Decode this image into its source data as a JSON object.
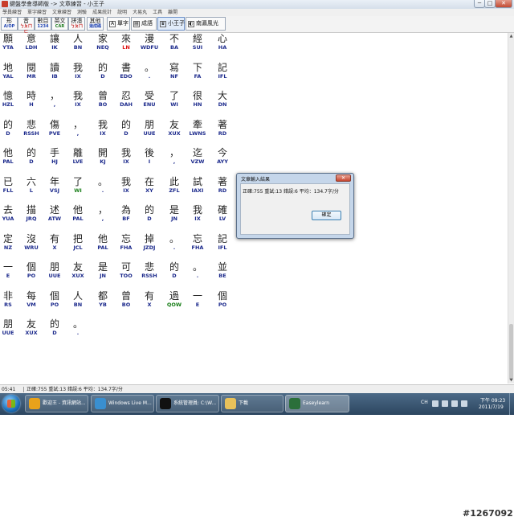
{
  "window": {
    "title": "鍵盤學會導師版 -> 文章練習 - 小王子",
    "controls": {
      "minimize": "─",
      "maximize": "□",
      "close": "✕"
    }
  },
  "menu": [
    "學員練習",
    "單字練習",
    "文章練習",
    "測驗",
    "成果統計",
    "說明",
    "大易丸",
    "工具",
    "離開"
  ],
  "toolbar": {
    "buttons": [
      {
        "top": "形",
        "bottom": "A/OP",
        "color": "#1a3fb0"
      },
      {
        "top": "音",
        "bottom": "ㄅㄆㄇㄈ",
        "color": "#c21a1a"
      },
      {
        "top": "數目",
        "bottom": "1234",
        "color": "#1a3fb0"
      },
      {
        "top": "英文",
        "bottom": "CAR",
        "color": "#1d7a1d"
      },
      {
        "top": "拼湊",
        "bottom": "ㄅㄆㄇ",
        "color": "#c21a1a"
      },
      {
        "top": "其他",
        "bottom": "速成碼",
        "color": "#1a3fb0"
      }
    ],
    "modes": [
      {
        "label": "單字",
        "icon": "A"
      },
      {
        "label": "成語",
        "icon": "▤"
      },
      {
        "label": "小王子",
        "icon": "♛"
      },
      {
        "label": "南瀛風光",
        "icon": "◐"
      }
    ]
  },
  "text_rows": [
    {
      "chars": [
        "願",
        "意",
        "讓",
        "人",
        "家",
        "來",
        "漫",
        "不",
        "經",
        "心"
      ],
      "codes": [
        "YTA",
        "LDH",
        "IK",
        "BN",
        "NEQ",
        "LN",
        "WDFU",
        "BA",
        "SUI",
        "HA"
      ],
      "code_colors": [
        "",
        "",
        "",
        "",
        "",
        "red",
        "",
        "",
        "",
        ""
      ]
    },
    {
      "chars": [
        "地",
        "閱",
        "讀",
        "我",
        "的",
        "書",
        "。",
        "寫",
        "下",
        "記"
      ],
      "codes": [
        "YAL",
        "MR",
        "IB",
        "IX",
        "D",
        "EDO",
        ".",
        "NF",
        "FA",
        "IFL"
      ],
      "code_colors": [
        "",
        "",
        "",
        "",
        "",
        "",
        "",
        "",
        "",
        ""
      ]
    },
    {
      "chars": [
        "憶",
        "時",
        "，",
        "我",
        "曾",
        "忍",
        "受",
        "了",
        "很",
        "大"
      ],
      "codes": [
        "HZL",
        "H",
        ",",
        "IX",
        "BO",
        "DAH",
        "ENU",
        "WI",
        "HN",
        "DN"
      ],
      "code_colors": [
        "",
        "",
        "",
        "",
        "",
        "",
        "",
        "",
        "",
        ""
      ]
    },
    {
      "chars": [
        "的",
        "悲",
        "傷",
        "，",
        "我",
        "的",
        "朋",
        "友",
        "牽",
        "著"
      ],
      "codes": [
        "D",
        "RSSH",
        "PVE",
        ",",
        "IX",
        "D",
        "UUE",
        "XUX",
        "LWNS",
        "RD"
      ],
      "code_colors": [
        "",
        "",
        "",
        "",
        "",
        "",
        "",
        "",
        "",
        ""
      ]
    },
    {
      "chars": [
        "他",
        "的",
        "手",
        "離",
        "開",
        "我",
        "後",
        "，",
        "迄",
        "今"
      ],
      "codes": [
        "PAL",
        "D",
        "HJ",
        "LVE",
        "KJ",
        "IX",
        "I",
        ",",
        "VZW",
        "AYY"
      ],
      "code_colors": [
        "",
        "",
        "",
        "",
        "",
        "",
        "",
        "",
        "",
        ""
      ]
    },
    {
      "chars": [
        "已",
        "六",
        "年",
        "了",
        "。",
        "我",
        "在",
        "此",
        "試",
        "著"
      ],
      "codes": [
        "FLL",
        "L",
        "VSJ",
        "WI",
        ".",
        "IX",
        "XY",
        "ZFL",
        "IAXI",
        "RD"
      ],
      "code_colors": [
        "",
        "",
        "",
        "green",
        "",
        "",
        "",
        "",
        "",
        ""
      ]
    },
    {
      "chars": [
        "去",
        "描",
        "述",
        "他",
        "，",
        "為",
        "的",
        "是",
        "我",
        "確"
      ],
      "codes": [
        "YUA",
        "JRQ",
        "ATW",
        "PAL",
        ",",
        "BF",
        "D",
        "JN",
        "IX",
        "LV"
      ],
      "code_colors": [
        "",
        "",
        "",
        "",
        "",
        "",
        "",
        "",
        "",
        ""
      ]
    },
    {
      "chars": [
        "定",
        "沒",
        "有",
        "把",
        "他",
        "忘",
        "掉",
        "。",
        "忘",
        "記"
      ],
      "codes": [
        "NZ",
        "WRU",
        "X",
        "JCL",
        "PAL",
        "FHA",
        "JZDJ",
        ".",
        "FHA",
        "IFL"
      ],
      "code_colors": [
        "",
        "",
        "",
        "",
        "",
        "",
        "",
        "",
        "",
        ""
      ]
    },
    {
      "chars": [
        "一",
        "個",
        "朋",
        "友",
        "是",
        "可",
        "悲",
        "的",
        "。",
        "並"
      ],
      "codes": [
        "E",
        "PO",
        "UUE",
        "XUX",
        "JN",
        "TOO",
        "RSSH",
        "D",
        ".",
        "BE"
      ],
      "code_colors": [
        "",
        "",
        "",
        "",
        "",
        "",
        "",
        "",
        "",
        ""
      ]
    },
    {
      "chars": [
        "非",
        "每",
        "個",
        "人",
        "都",
        "曾",
        "有",
        "過",
        "一",
        "個"
      ],
      "codes": [
        "RS",
        "VM",
        "PO",
        "BN",
        "YB",
        "BO",
        "X",
        "QOW",
        "E",
        "PO"
      ],
      "code_colors": [
        "",
        "",
        "",
        "",
        "",
        "",
        "",
        "green",
        "",
        ""
      ]
    },
    {
      "chars": [
        "朋",
        "友",
        "的",
        "。"
      ],
      "codes": [
        "UUE",
        "XUX",
        "D",
        "."
      ],
      "code_colors": [
        "",
        "",
        "",
        ""
      ]
    }
  ],
  "dialog": {
    "title": "文章輸入結果",
    "close": "✕",
    "message": "正確:755 重試:13 錯誤:6 平均：134.7字/分",
    "ok_label": "確定"
  },
  "statusbar": {
    "time": "05:41",
    "message": "正確:755 重試:13 錯誤:6 平均：134.7字/分"
  },
  "taskbar": {
    "items": [
      {
        "label": "歡迎王 - 資訊網站...",
        "color": "#e8a21b"
      },
      {
        "label": "Windows Live M...",
        "color": "#3a8fd0"
      },
      {
        "label": "系統管理員: C:\\W...",
        "color": "#111111"
      },
      {
        "label": "下載",
        "color": "#e8c15a"
      },
      {
        "label": "Easeylearn",
        "color": "#2b6f3a"
      }
    ],
    "ime": "CH",
    "clock_time": "下午 09:23",
    "clock_date": "2011/7/19"
  },
  "watermark": "#1267092",
  "colors": {
    "code_blue": "#1c2a8c",
    "code_red": "#d11111",
    "code_green": "#1a7f1a"
  }
}
